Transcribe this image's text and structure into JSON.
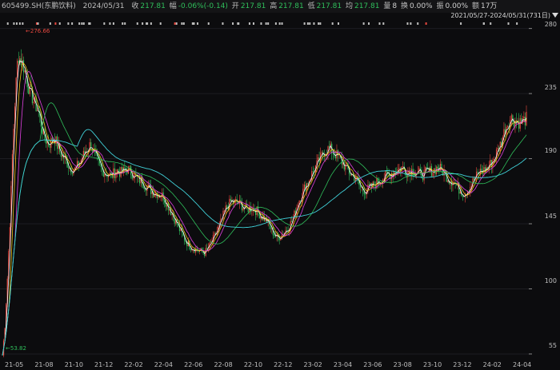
{
  "info": {
    "code": "605499.SH(东鹏饮料)",
    "date": "2024/05/31",
    "close_label": "收",
    "close": "217.81",
    "change_label": "幅",
    "change": "-0.06%(-0.14)",
    "open_label": "开",
    "open": "217.81",
    "high_label": "高",
    "high": "217.81",
    "low_label": "低",
    "low": "217.81",
    "avg_label": "均",
    "avg": "217.81",
    "volume_label": "量",
    "volume": "8",
    "turnover_label": "换",
    "turnover": "0.00%",
    "amplitude_label": "振",
    "amplitude": "0.00%",
    "amount_label": "额",
    "amount": "17万"
  },
  "range": {
    "text": "2021/05/27-2024/05/31(731日)"
  },
  "annotations": {
    "max_label": "276.66",
    "min_label": "53.82"
  },
  "colors": {
    "up": "#e8483f",
    "down": "#2fbf5b",
    "ma5": "#ffffff",
    "ma10": "#f2c318",
    "ma20": "#e040e0",
    "ma60": "#2fbf5b",
    "ma120": "#40d0d8"
  },
  "chart_data": {
    "type": "candlestick",
    "x_range": [
      "2021-05-27",
      "2024-05-31"
    ],
    "ylim": [
      50,
      282
    ],
    "y_ticks": [
      55,
      100,
      145,
      190,
      235,
      280
    ],
    "x_ticks": [
      "21-05",
      "21-08",
      "21-10",
      "21-12",
      "22-02",
      "22-04",
      "22-06",
      "22-08",
      "22-10",
      "22-12",
      "23-02",
      "23-04",
      "23-06",
      "23-08",
      "23-10",
      "23-12",
      "24-02",
      "24-04"
    ],
    "max_price": 276.66,
    "min_price": 53.82,
    "close_series": [
      [
        0,
        54
      ],
      [
        1,
        75
      ],
      [
        2,
        110
      ],
      [
        3,
        150
      ],
      [
        4,
        200
      ],
      [
        5,
        235
      ],
      [
        6,
        262
      ],
      [
        8,
        255
      ],
      [
        10,
        240
      ],
      [
        12,
        230
      ],
      [
        14,
        222
      ],
      [
        16,
        205
      ],
      [
        18,
        200
      ],
      [
        20,
        205
      ],
      [
        22,
        195
      ],
      [
        24,
        190
      ],
      [
        26,
        184
      ],
      [
        28,
        182
      ],
      [
        30,
        188
      ],
      [
        32,
        195
      ],
      [
        34,
        200
      ],
      [
        36,
        190
      ],
      [
        38,
        183
      ],
      [
        40,
        180
      ],
      [
        42,
        178
      ],
      [
        44,
        182
      ],
      [
        46,
        180
      ],
      [
        48,
        183
      ],
      [
        50,
        180
      ],
      [
        52,
        176
      ],
      [
        54,
        174
      ],
      [
        56,
        170
      ],
      [
        58,
        167
      ],
      [
        60,
        166
      ],
      [
        62,
        164
      ],
      [
        64,
        157
      ],
      [
        66,
        150
      ],
      [
        68,
        142
      ],
      [
        70,
        135
      ],
      [
        72,
        130
      ],
      [
        74,
        128
      ],
      [
        76,
        126
      ],
      [
        78,
        125
      ],
      [
        80,
        130
      ],
      [
        82,
        137
      ],
      [
        84,
        145
      ],
      [
        86,
        155
      ],
      [
        88,
        160
      ],
      [
        90,
        160
      ],
      [
        92,
        158
      ],
      [
        94,
        155
      ],
      [
        96,
        156
      ],
      [
        98,
        154
      ],
      [
        100,
        150
      ],
      [
        102,
        147
      ],
      [
        104,
        140
      ],
      [
        106,
        135
      ],
      [
        108,
        138
      ],
      [
        110,
        142
      ],
      [
        112,
        148
      ],
      [
        114,
        160
      ],
      [
        116,
        168
      ],
      [
        118,
        175
      ],
      [
        120,
        182
      ],
      [
        122,
        188
      ],
      [
        124,
        195
      ],
      [
        126,
        197
      ],
      [
        128,
        194
      ],
      [
        130,
        190
      ],
      [
        132,
        185
      ],
      [
        134,
        180
      ],
      [
        136,
        177
      ],
      [
        138,
        170
      ],
      [
        140,
        168
      ],
      [
        142,
        170
      ],
      [
        144,
        173
      ],
      [
        146,
        176
      ],
      [
        148,
        178
      ],
      [
        150,
        180
      ],
      [
        152,
        182
      ],
      [
        154,
        184
      ],
      [
        156,
        181
      ],
      [
        158,
        182
      ],
      [
        160,
        180
      ],
      [
        162,
        179
      ],
      [
        164,
        181
      ],
      [
        166,
        182
      ],
      [
        168,
        184
      ],
      [
        170,
        181
      ],
      [
        172,
        176
      ],
      [
        174,
        174
      ],
      [
        176,
        169
      ],
      [
        178,
        166
      ],
      [
        180,
        170
      ],
      [
        182,
        176
      ],
      [
        184,
        181
      ],
      [
        186,
        182
      ],
      [
        188,
        186
      ],
      [
        190,
        192
      ],
      [
        192,
        200
      ],
      [
        194,
        212
      ],
      [
        196,
        218
      ],
      [
        198,
        216
      ],
      [
        200,
        215
      ],
      [
        202,
        217.81
      ]
    ],
    "series": [
      {
        "name": "MA5",
        "values": "close-smoothed-5"
      },
      {
        "name": "MA10",
        "values": "close-smoothed-10"
      },
      {
        "name": "MA20",
        "values": "close-smoothed-20"
      },
      {
        "name": "MA60",
        "values": "close-smoothed-60"
      },
      {
        "name": "MA120",
        "values": "close-smoothed-120"
      }
    ]
  }
}
